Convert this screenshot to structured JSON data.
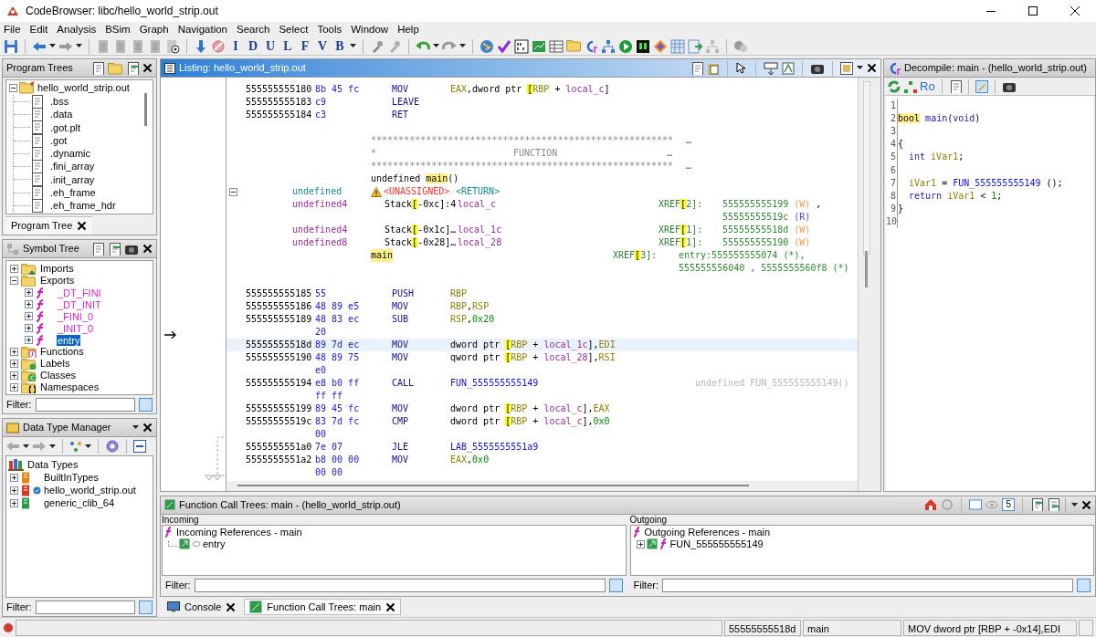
{
  "window": {
    "title": "CodeBrowser: libc/hello_world_strip.out"
  },
  "menu": [
    "File",
    "Edit",
    "Analysis",
    "BSim",
    "Graph",
    "Navigation",
    "Search",
    "Select",
    "Tools",
    "Window",
    "Help"
  ],
  "toolbar": {
    "letter_buttons": [
      "I",
      "D",
      "U",
      "L",
      "F",
      "V",
      "B"
    ]
  },
  "program_trees": {
    "title": "Program Trees",
    "root": {
      "label": "hello_world_strip.out",
      "expanded": true,
      "children": [
        ".bss",
        ".data",
        ".got.plt",
        ".got",
        ".dynamic",
        ".fini_array",
        ".init_array",
        ".eh_frame",
        ".eh_frame_hdr"
      ]
    },
    "tabs": [
      {
        "label": "Program Tree",
        "selected": true
      }
    ]
  },
  "symbol_tree": {
    "title": "Symbol Tree",
    "items": [
      {
        "label": "Imports",
        "expanded": false,
        "selected": false
      },
      {
        "label": "Exports",
        "expanded": true,
        "selected": false,
        "children": [
          {
            "label": "_DT_FINI",
            "expanded": false,
            "selected": false
          },
          {
            "label": "_DT_INIT",
            "expanded": false,
            "selected": false
          },
          {
            "label": "_FINI_0",
            "expanded": false,
            "selected": false
          },
          {
            "label": "_INIT_0",
            "expanded": false,
            "selected": false
          },
          {
            "label": "entry",
            "expanded": false,
            "selected": true
          }
        ]
      },
      {
        "label": "Functions",
        "expanded": false,
        "selected": false
      },
      {
        "label": "Labels",
        "expanded": false,
        "selected": false
      },
      {
        "label": "Classes",
        "expanded": false,
        "selected": false
      },
      {
        "label": "Namespaces",
        "expanded": false,
        "selected": false
      }
    ],
    "filter_label": "Filter:"
  },
  "data_type_manager": {
    "title": "Data Type Manager",
    "root": {
      "label": "Data Types",
      "children": [
        {
          "label": "BuiltInTypes",
          "expanded": false
        },
        {
          "label": "hello_world_strip.out",
          "expanded": false
        },
        {
          "label": "generic_clib_64",
          "expanded": false
        }
      ]
    },
    "filter_label": "Filter:"
  },
  "listing": {
    "title": "Listing:  hello_world_strip.out",
    "rows": [
      {
        "kind": "code",
        "selected": false,
        "address": "555555555180",
        "bytes": [
          "8b 45 fc"
        ],
        "mnemonic": "MOV",
        "operands": [
          {
            "text": "EAX",
            "kind": "register"
          },
          {
            "text": ",dword ptr ",
            "kind": "plain"
          },
          {
            "text": "[",
            "kind": "bracket"
          },
          {
            "text": "RBP",
            "kind": "register"
          },
          {
            "text": " + ",
            "kind": "plain"
          },
          {
            "text": "local_c",
            "kind": "local"
          },
          {
            "text": "]",
            "kind": "plain"
          }
        ]
      },
      {
        "kind": "code",
        "selected": false,
        "address": "555555555183",
        "bytes": [
          "c9"
        ],
        "mnemonic": "LEAVE"
      },
      {
        "kind": "code",
        "selected": false,
        "address": "555555555184",
        "bytes": [
          "c3"
        ],
        "mnemonic": "RET"
      },
      {
        "kind": "blank"
      },
      {
        "kind": "stars",
        "text": "*******************************************************",
        "ellipsis": "…"
      },
      {
        "kind": "banner",
        "left": "*",
        "center": "FUNCTION",
        "ellipsis": "…"
      },
      {
        "kind": "stars",
        "text": "*******************************************************",
        "ellipsis": "…"
      },
      {
        "kind": "signature",
        "tokens": [
          {
            "text": "undefined ",
            "kind": "plain"
          },
          {
            "text": "main",
            "kind": "highlight"
          },
          {
            "text": "()",
            "kind": "plain"
          }
        ]
      },
      {
        "kind": "return",
        "expanded": true,
        "type": "undefined",
        "storage": "<UNASSIGNED>",
        "name": "<RETURN>"
      },
      {
        "kind": "variable",
        "type": "undefined4",
        "storage": [
          {
            "text": "Stack",
            "kind": "plain"
          },
          {
            "text": "[",
            "kind": "bracket"
          },
          {
            "text": "-0xc]:4",
            "kind": "plain"
          }
        ],
        "name": "local_c",
        "xref_label": [
          {
            "text": "XREF",
            "kind": "xref"
          },
          {
            "text": "[",
            "kind": "bracket"
          },
          {
            "text": "2]:",
            "kind": "xref"
          }
        ],
        "xrefs": [
          [
            {
              "text": "555555555199 ",
              "kind": "xref_address"
            },
            {
              "text": "(W)",
              "kind": "write"
            },
            {
              "text": " ,",
              "kind": "plain"
            }
          ],
          [
            {
              "text": "55555555519c ",
              "kind": "xref_address"
            },
            {
              "text": "(R)",
              "kind": "read"
            }
          ]
        ]
      },
      {
        "kind": "variable",
        "type": "undefined4",
        "storage": [
          {
            "text": "Stack",
            "kind": "plain"
          },
          {
            "text": "[",
            "kind": "bracket"
          },
          {
            "text": "-0x1c]…",
            "kind": "plain"
          }
        ],
        "name": "local_1c",
        "xref_label": [
          {
            "text": "XREF",
            "kind": "xref"
          },
          {
            "text": "[",
            "kind": "bracket"
          },
          {
            "text": "1]:",
            "kind": "xref"
          }
        ],
        "xrefs": [
          [
            {
              "text": "55555555518d ",
              "kind": "xref_address"
            },
            {
              "text": "(W)",
              "kind": "write"
            }
          ]
        ]
      },
      {
        "kind": "variable",
        "type": "undefined8",
        "storage": [
          {
            "text": "Stack",
            "kind": "plain"
          },
          {
            "text": "[",
            "kind": "bracket"
          },
          {
            "text": "-0x28]…",
            "kind": "plain"
          }
        ],
        "name": "local_28",
        "xref_label": [
          {
            "text": "XREF",
            "kind": "xref"
          },
          {
            "text": "[",
            "kind": "bracket"
          },
          {
            "text": "1]:",
            "kind": "xref"
          }
        ],
        "xrefs": [
          [
            {
              "text": "555555555190 ",
              "kind": "xref_address"
            },
            {
              "text": "(W)",
              "kind": "write"
            }
          ]
        ]
      },
      {
        "kind": "label",
        "name": "main",
        "xref_label": [
          {
            "text": "XREF",
            "kind": "xref"
          },
          {
            "text": "[",
            "kind": "bracket"
          },
          {
            "text": "3]:",
            "kind": "xref"
          }
        ],
        "xrefs": [
          [
            {
              "text": "entry:555555555074 (*),",
              "kind": "xref_address"
            }
          ],
          [
            {
              "text": "555555556040 , 5555555560f8 (*)",
              "kind": "xref_address"
            }
          ]
        ]
      },
      {
        "kind": "blank"
      },
      {
        "kind": "code",
        "selected": false,
        "address": "555555555185",
        "bytes": [
          "55"
        ],
        "mnemonic": "PUSH",
        "operands": [
          {
            "text": "RBP",
            "kind": "register"
          }
        ]
      },
      {
        "kind": "code",
        "selected": false,
        "address": "555555555186",
        "bytes": [
          "48 89 e5"
        ],
        "mnemonic": "MOV",
        "operands": [
          {
            "text": "RBP",
            "kind": "register"
          },
          {
            "text": ",",
            "kind": "plain"
          },
          {
            "text": "RSP",
            "kind": "register"
          }
        ]
      },
      {
        "kind": "code",
        "selected": false,
        "address": "555555555189",
        "bytes": [
          "48 83 ec",
          "20"
        ],
        "mnemonic": "SUB",
        "operands": [
          {
            "text": "RSP",
            "kind": "register"
          },
          {
            "text": ",",
            "kind": "plain"
          },
          {
            "text": "0x20",
            "kind": "number"
          }
        ]
      },
      {
        "kind": "code",
        "selected": true,
        "address": "55555555518d",
        "bytes": [
          "89 7d ec"
        ],
        "mnemonic": "MOV",
        "operands": [
          {
            "text": "dword ptr ",
            "kind": "plain"
          },
          {
            "text": "[",
            "kind": "bracket"
          },
          {
            "text": "RBP",
            "kind": "register"
          },
          {
            "text": " + ",
            "kind": "plain"
          },
          {
            "text": "local_1c",
            "kind": "local"
          },
          {
            "text": "],",
            "kind": "plain"
          },
          {
            "text": "EDI",
            "kind": "register"
          }
        ]
      },
      {
        "kind": "code",
        "selected": false,
        "address": "555555555190",
        "bytes": [
          "48 89 75",
          "e0"
        ],
        "mnemonic": "MOV",
        "operands": [
          {
            "text": "qword ptr ",
            "kind": "plain"
          },
          {
            "text": "[",
            "kind": "bracket"
          },
          {
            "text": "RBP",
            "kind": "register"
          },
          {
            "text": " + ",
            "kind": "plain"
          },
          {
            "text": "local_28",
            "kind": "local"
          },
          {
            "text": "],",
            "kind": "plain"
          },
          {
            "text": "RSI",
            "kind": "register"
          }
        ]
      },
      {
        "kind": "code",
        "selected": false,
        "address": "555555555194",
        "bytes": [
          "e8 b0 ff",
          "ff ff"
        ],
        "mnemonic": "CALL",
        "operands": [
          {
            "text": "FUN_555555555149",
            "kind": "function"
          }
        ],
        "comment": "undefined FUN_555555555149()"
      },
      {
        "kind": "code",
        "selected": false,
        "address": "555555555199",
        "bytes": [
          "89 45 fc"
        ],
        "mnemonic": "MOV",
        "operands": [
          {
            "text": "dword ptr ",
            "kind": "plain"
          },
          {
            "text": "[",
            "kind": "bracket"
          },
          {
            "text": "RBP",
            "kind": "register"
          },
          {
            "text": " + ",
            "kind": "plain"
          },
          {
            "text": "local_c",
            "kind": "local"
          },
          {
            "text": "],",
            "kind": "plain"
          },
          {
            "text": "EAX",
            "kind": "register"
          }
        ]
      },
      {
        "kind": "code",
        "selected": false,
        "address": "55555555519c",
        "bytes": [
          "83 7d fc",
          "00"
        ],
        "mnemonic": "CMP",
        "operands": [
          {
            "text": "dword ptr ",
            "kind": "plain"
          },
          {
            "text": "[",
            "kind": "bracket"
          },
          {
            "text": "RBP",
            "kind": "register"
          },
          {
            "text": " + ",
            "kind": "plain"
          },
          {
            "text": "local_c",
            "kind": "local"
          },
          {
            "text": "],",
            "kind": "plain"
          },
          {
            "text": "0x0",
            "kind": "number"
          }
        ]
      },
      {
        "kind": "code",
        "selected": false,
        "address": "5555555551a0",
        "bytes": [
          "7e 07"
        ],
        "mnemonic": "JLE",
        "operands": [
          {
            "text": "LAB_5555555551a9",
            "kind": "function"
          }
        ]
      },
      {
        "kind": "code",
        "selected": false,
        "address": "5555555551a2",
        "bytes": [
          "b8 00 00",
          "00 00"
        ],
        "mnemonic": "MOV",
        "operands": [
          {
            "text": "EAX",
            "kind": "register"
          },
          {
            "text": ",",
            "kind": "plain"
          },
          {
            "text": "0x0",
            "kind": "number"
          }
        ]
      }
    ]
  },
  "decompile": {
    "title": "Decompile: main -  (hello_world_strip.out)",
    "toolbar_text": "Ro",
    "lines": [
      {
        "number": "1"
      },
      {
        "number": "2",
        "indent": false,
        "tokens": [
          {
            "text": "bool",
            "kind": "highlight"
          },
          {
            "text": " main",
            "kind": "function"
          },
          {
            "text": "(",
            "kind": "plain"
          },
          {
            "text": "void",
            "kind": "keyword"
          },
          {
            "text": ")",
            "kind": "plain"
          }
        ]
      },
      {
        "number": "3"
      },
      {
        "number": "4",
        "indent": false,
        "tokens": [
          {
            "text": "{",
            "kind": "plain"
          }
        ]
      },
      {
        "number": "5",
        "indent": true,
        "tokens": [
          {
            "text": "int ",
            "kind": "keyword"
          },
          {
            "text": "iVar1",
            "kind": "variable"
          },
          {
            "text": ";",
            "kind": "plain"
          }
        ]
      },
      {
        "number": "6"
      },
      {
        "number": "7",
        "indent": true,
        "tokens": [
          {
            "text": "iVar1",
            "kind": "variable"
          },
          {
            "text": " = ",
            "kind": "plain"
          },
          {
            "text": "FUN_555555555149",
            "kind": "function"
          },
          {
            "text": " ();",
            "kind": "plain"
          }
        ]
      },
      {
        "number": "8",
        "indent": true,
        "tokens": [
          {
            "text": "return ",
            "kind": "keyword"
          },
          {
            "text": "iVar1",
            "kind": "variable"
          },
          {
            "text": " < ",
            "kind": "plain"
          },
          {
            "text": "1",
            "kind": "number"
          },
          {
            "text": ";",
            "kind": "plain"
          }
        ]
      },
      {
        "number": "9",
        "indent": false,
        "tokens": [
          {
            "text": "}",
            "kind": "plain"
          }
        ]
      },
      {
        "number": "10"
      }
    ]
  },
  "call_trees": {
    "title": "Function Call Trees: main -  (hello_world_strip.out)",
    "depth": "5",
    "incoming": {
      "label": "Incoming",
      "root": "Incoming References - main",
      "children": [
        {
          "label": "entry",
          "expandable": false
        }
      ],
      "filter_label": "Filter:"
    },
    "outgoing": {
      "label": "Outgoing",
      "root": "Outgoing References - main",
      "children": [
        {
          "label": "FUN_555555555149",
          "expanded": false,
          "expandable": true
        }
      ],
      "filter_label": "Filter:"
    }
  },
  "bottom_tabs": [
    {
      "label": "Console",
      "selected": false
    },
    {
      "label": "Function Call Trees: main",
      "selected": true
    }
  ],
  "status_bar": [
    "55555555518d",
    "main",
    "MOV dword ptr [RBP + -0x14],EDI"
  ]
}
